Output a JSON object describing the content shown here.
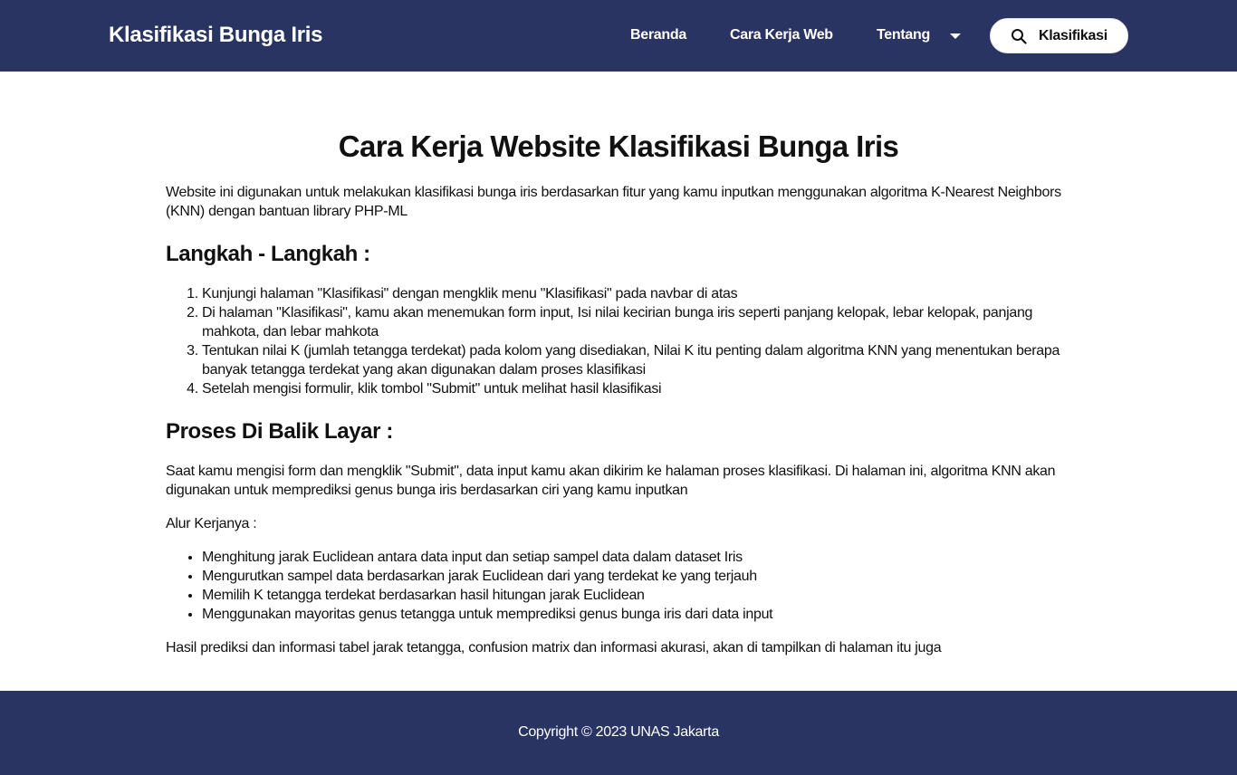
{
  "navbar": {
    "brand": "Klasifikasi Bunga Iris",
    "links": [
      "Beranda",
      "Cara Kerja Web",
      "Tentang"
    ],
    "button_label": "Klasifikasi",
    "bg_color": "#293462"
  },
  "main": {
    "title": "Cara Kerja Website Klasifikasi Bunga Iris",
    "intro": "Website ini digunakan untuk melakukan klasifikasi bunga iris berdasarkan fitur yang kamu inputkan menggunakan algoritma K-Nearest Neighbors (KNN) dengan bantuan library PHP-ML",
    "steps_heading": "Langkah - Langkah :",
    "steps": [
      "Kunjungi halaman \"Klasifikasi\" dengan mengklik menu \"Klasifikasi\" pada navbar di atas",
      "Di halaman \"Klasifikasi\", kamu akan menemukan form input, Isi nilai kecirian bunga iris seperti panjang kelopak, lebar kelopak, panjang mahkota, dan lebar mahkota",
      "Tentukan nilai K (jumlah tetangga terdekat) pada kolom yang disediakan, Nilai K itu penting dalam algoritma KNN yang menentukan berapa banyak tetangga terdekat yang akan digunakan dalam proses klasifikasi",
      "Setelah mengisi formulir, klik tombol \"Submit\" untuk melihat hasil klasifikasi"
    ],
    "process_heading": "Proses Di Balik Layar :",
    "process_text": "Saat kamu mengisi form dan mengklik \"Submit\", data input kamu akan dikirim ke halaman proses klasifikasi. Di halaman ini, algoritma KNN akan digunakan untuk memprediksi genus bunga iris berdasarkan ciri yang kamu inputkan",
    "flow_label": "Alur Kerjanya :",
    "flow": [
      "Menghitung jarak Euclidean antara data input dan setiap sampel data dalam dataset Iris",
      "Mengurutkan sampel data berdasarkan jarak Euclidean dari yang terdekat ke yang terjauh",
      "Memilih K tetangga terdekat berdasarkan hasil hitungan jarak Euclidean",
      "Menggunakan mayoritas genus tetangga untuk memprediksi genus bunga iris dari data input"
    ],
    "closing": "Hasil prediksi dan informasi tabel jarak tetangga, confusion matrix dan informasi akurasi, akan di tampilkan di halaman itu juga"
  },
  "footer": {
    "copyright": "Copyright © 2023 UNAS Jakarta"
  }
}
